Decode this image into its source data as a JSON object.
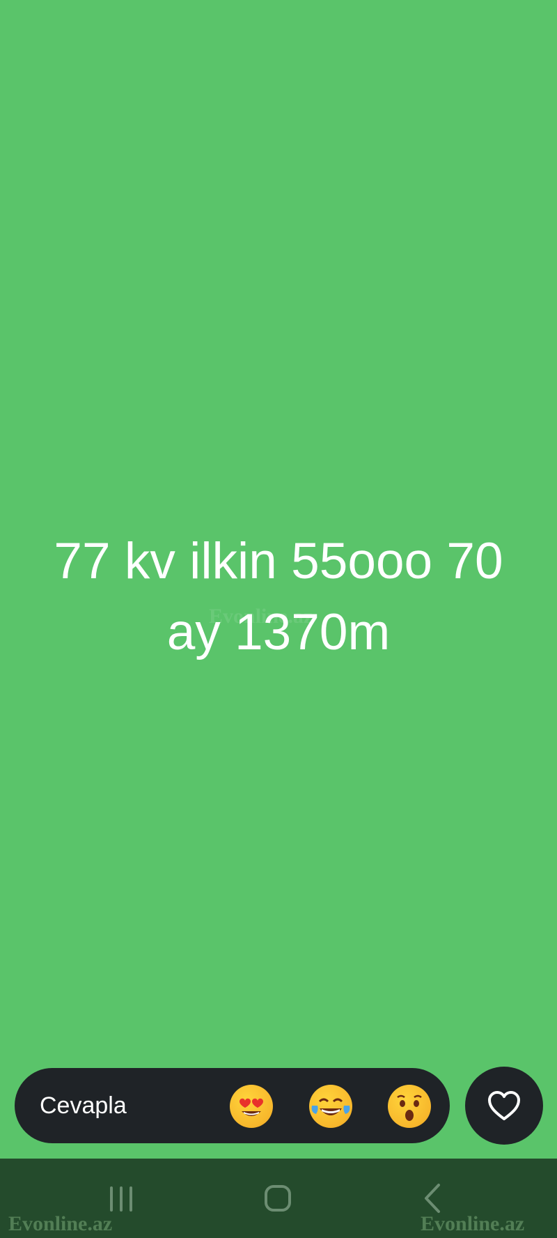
{
  "status": {
    "text": "77 kv ilkin 55ooo 70 ay 1370m",
    "background_color": "#5ac46a"
  },
  "reply": {
    "label": "Cevapla",
    "emojis": [
      {
        "icon": "heart-eyes-emoji-icon"
      },
      {
        "icon": "tears-of-joy-emoji-icon"
      },
      {
        "icon": "surprised-emoji-icon"
      }
    ],
    "like_icon": "heart-outline-icon"
  },
  "nav": {
    "recent_icon": "recent-apps-icon",
    "home_icon": "home-icon",
    "back_icon": "back-chevron-icon"
  },
  "watermark": {
    "left": "Evonline.az",
    "right": "Evonline.az",
    "center": "Evonline.az"
  }
}
